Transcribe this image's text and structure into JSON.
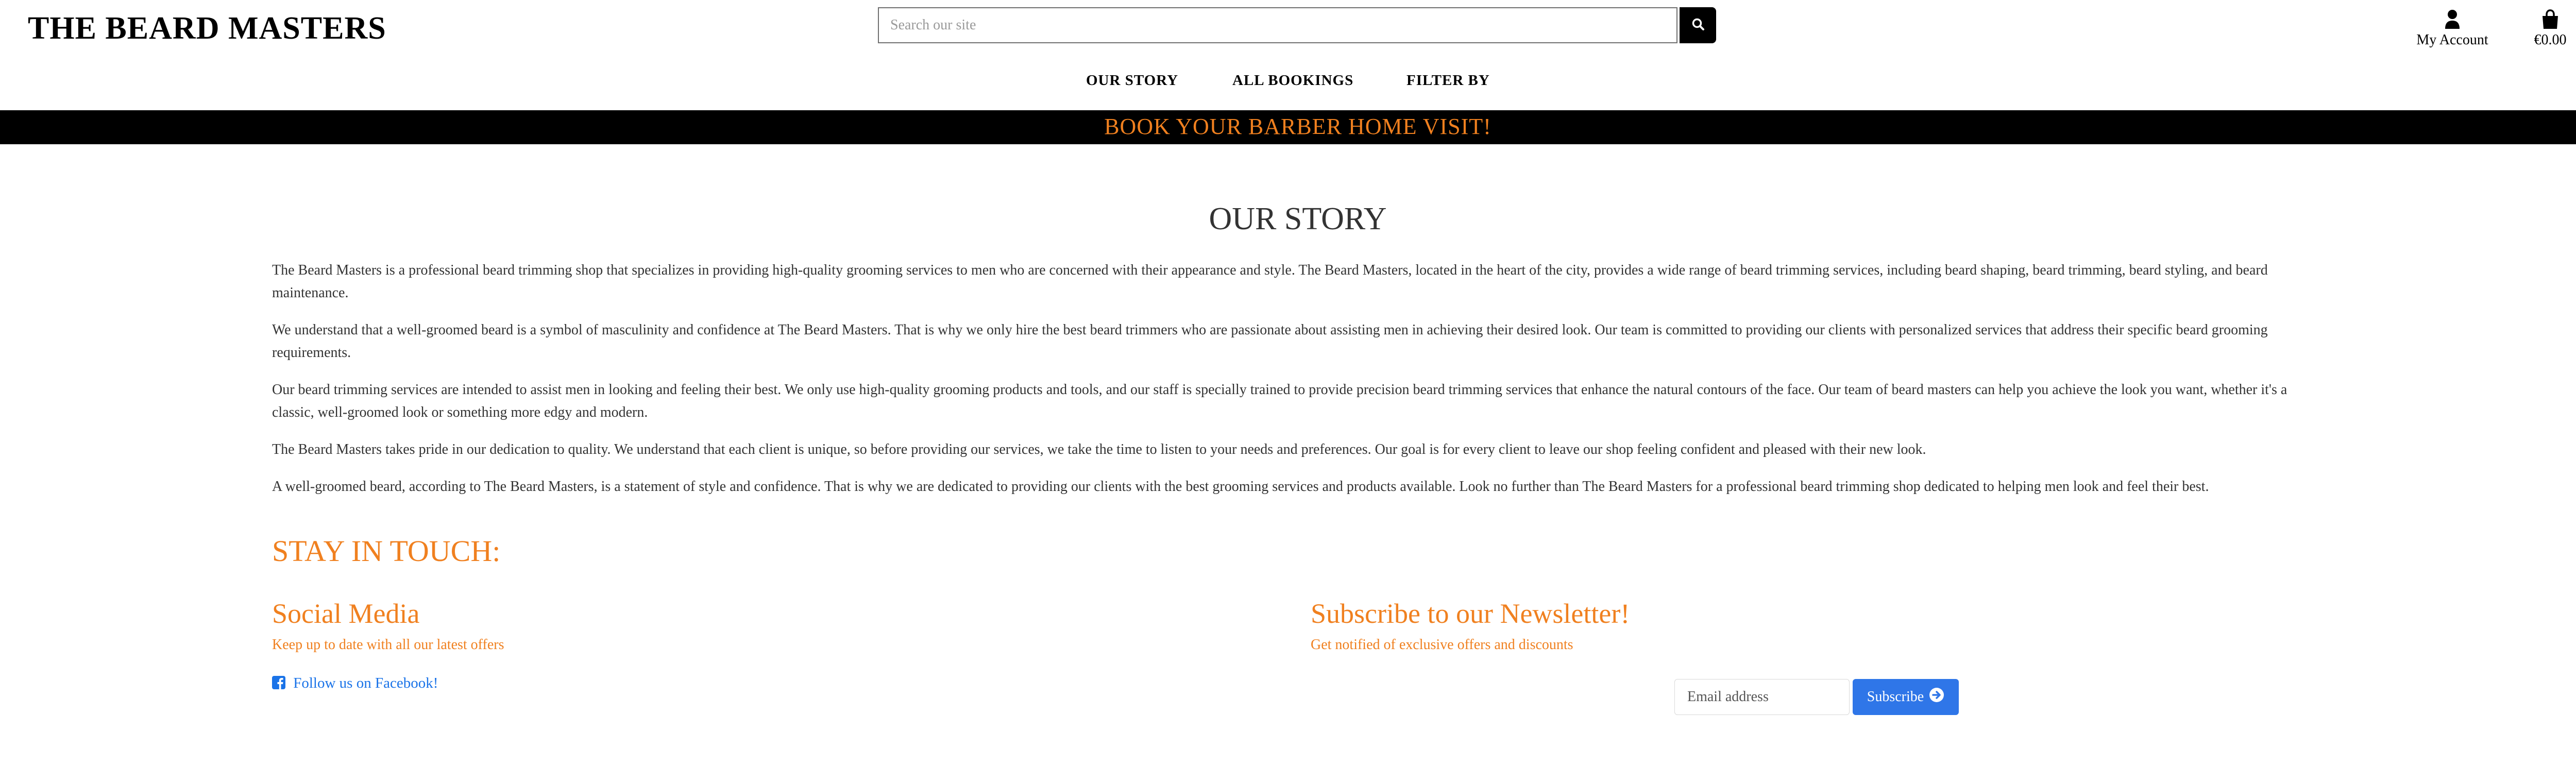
{
  "header": {
    "brand": "THE BEARD MASTERS",
    "search_placeholder": "Search our site",
    "account_label": "My Account",
    "cart_total": "€0.00",
    "icons": {
      "search": "search-icon",
      "account": "user-icon",
      "cart": "shopping-bag-icon"
    }
  },
  "nav": {
    "items": [
      {
        "label": "OUR STORY"
      },
      {
        "label": "ALL BOOKINGS"
      },
      {
        "label": "FILTER BY"
      }
    ]
  },
  "banner": {
    "text": "BOOK YOUR BARBER HOME VISIT!",
    "color": "#f0801f"
  },
  "main": {
    "title": "OUR STORY",
    "paragraphs": [
      "The Beard Masters is a professional beard trimming shop that specializes in providing high-quality grooming services to men who are concerned with their appearance and style. The Beard Masters, located in the heart of the city, provides a wide range of beard trimming services, including beard shaping, beard trimming, beard styling, and beard maintenance.",
      "We understand that a well-groomed beard is a symbol of masculinity and confidence at The Beard Masters. That is why we only hire the best beard trimmers who are passionate about assisting men in achieving their desired look. Our team is committed to providing our clients with personalized services that address their specific beard grooming requirements.",
      "Our beard trimming services are intended to assist men in looking and feeling their best. We only use high-quality grooming products and tools, and our staff is specially trained to provide precision beard trimming services that enhance the natural contours of the face. Our team of beard masters can help you achieve the look you want, whether it's a classic, well-groomed look or something more edgy and modern.",
      "The Beard Masters takes pride in our dedication to quality. We understand that each client is unique, so before providing our services, we take the time to listen to your needs and preferences. Our goal is for every client to leave our shop feeling confident and pleased with their new look.",
      "A well-groomed beard, according to The Beard Masters, is a statement of style and confidence. That is why we are dedicated to providing our clients with the best grooming services and products available. Look no further than The Beard Masters for a professional beard trimming shop dedicated to helping men look and feel their best."
    ]
  },
  "footer": {
    "stay_title": "STAY IN TOUCH:",
    "social": {
      "title": "Social Media",
      "subtitle": "Keep up to date with all our latest offers",
      "facebook_link": "Follow us on Facebook!",
      "icon": "facebook-icon"
    },
    "newsletter": {
      "title": "Subscribe to our Newsletter!",
      "subtitle": "Get notified of exclusive offers and discounts",
      "email_placeholder": "Email address",
      "subscribe_label": "Subscribe",
      "icon": "arrow-circle-right-icon"
    }
  },
  "colors": {
    "accent": "#f0801f",
    "link": "#1a73e8",
    "button": "#2f76e8",
    "dark": "#000000"
  }
}
